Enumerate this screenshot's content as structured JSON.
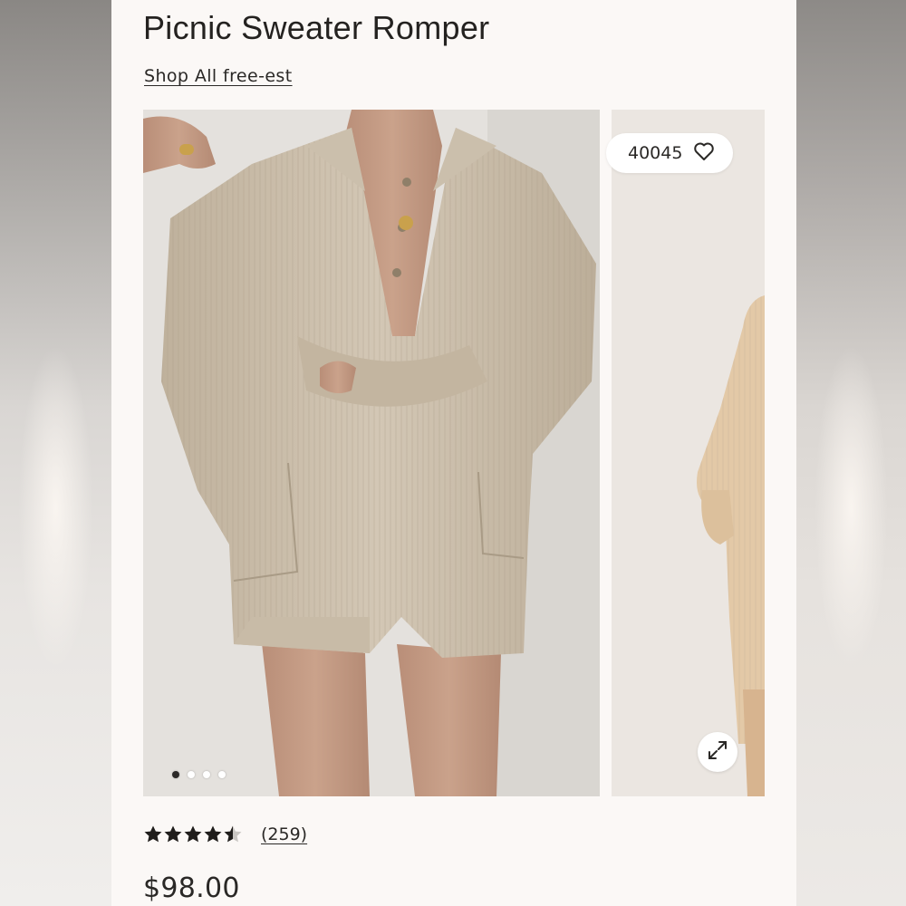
{
  "product": {
    "title": "Picnic Sweater Romper",
    "shop_link": "Shop All free-est",
    "likes": "40045",
    "rating_value": 4.5,
    "rating_max": 5,
    "review_count": "(259)",
    "price": "$98.00"
  },
  "gallery": {
    "dot_count": 4,
    "active_index": 0
  },
  "icons": {
    "like": "heart-outline-icon",
    "expand": "expand-arrows-icon",
    "star": "star-icon"
  },
  "colors": {
    "text": "#242220",
    "page_bg": "#fbf8f6",
    "sweater": "#cfc2ae",
    "star_filled": "#1f1d1b",
    "star_empty": "#c9c6c2"
  }
}
